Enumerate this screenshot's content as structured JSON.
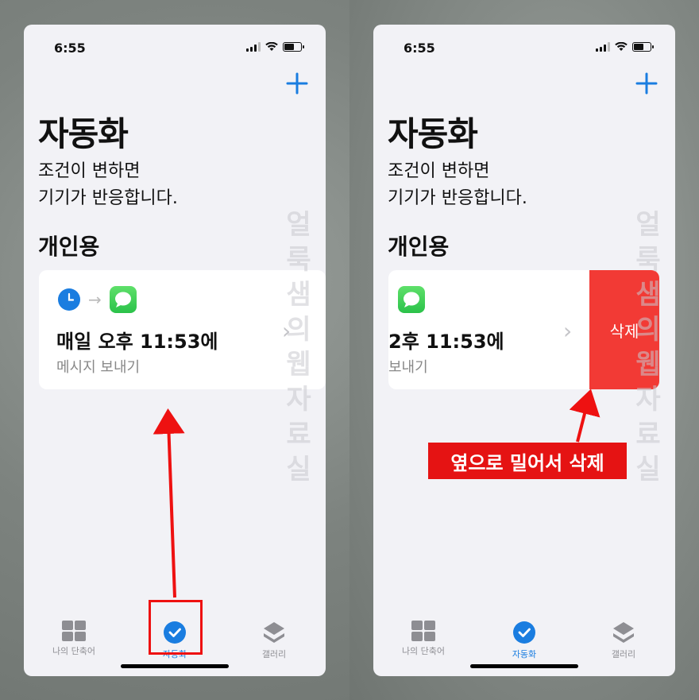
{
  "status": {
    "time": "6:55"
  },
  "header": {
    "title": "자동화",
    "subtitle_lines": [
      "조건이 변하면",
      "기기가 반응합니다."
    ],
    "section": "개인용"
  },
  "automation": {
    "main_left": "매일 오후 11:53에",
    "sub_left": "메시지 보내기",
    "main_right": "2후 11:53에",
    "sub_right": "보내기"
  },
  "delete_label": "삭제",
  "tabs": [
    {
      "label": "나의 단축어",
      "icon": "grid-icon"
    },
    {
      "label": "자동화",
      "icon": "clock-check-icon"
    },
    {
      "label": "갤러리",
      "icon": "layers-icon"
    }
  ],
  "watermark": [
    "얼",
    "룩",
    "샘",
    "의",
    "웹",
    "자",
    "료",
    "실"
  ],
  "annotation": {
    "callout": "옆으로 밀어서 삭제"
  },
  "colors": {
    "accent": "#1a7de0",
    "delete": "#f23a35",
    "annotation": "#e51313"
  }
}
